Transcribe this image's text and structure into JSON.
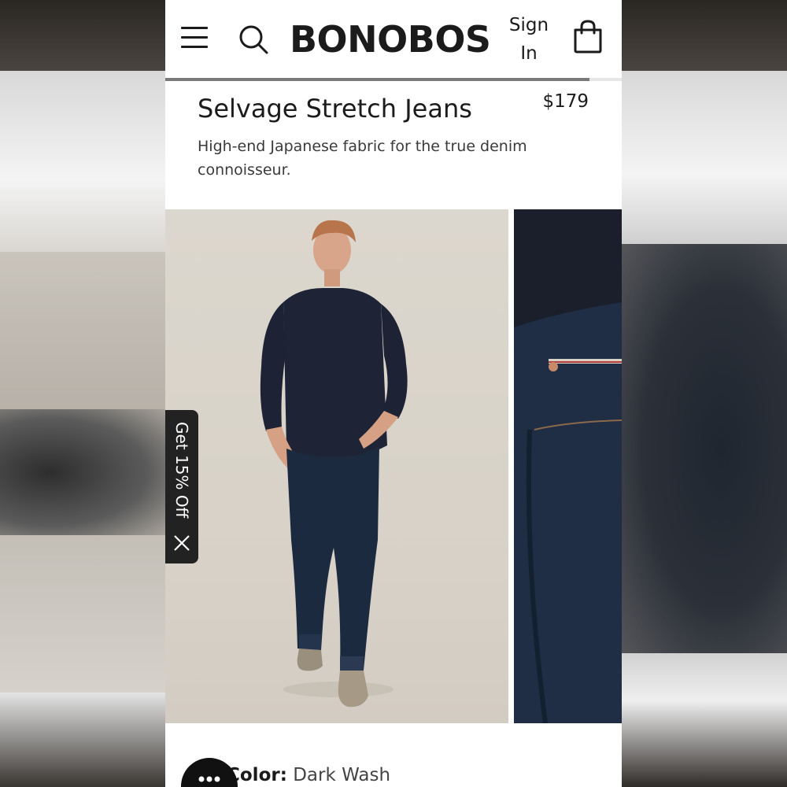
{
  "header": {
    "logo": "BONOBOS",
    "signin_line1": "Sign",
    "signin_line2": "In",
    "menu_icon": "hamburger-menu-icon",
    "search_icon": "search-icon",
    "bag_icon": "shopping-bag-icon"
  },
  "scroll_progress": 0.93,
  "product": {
    "title": "Selvage Stretch Jeans",
    "price": "$179",
    "description": "High-end Japanese fabric for the true denim connoisseur.",
    "color_label": "Color:",
    "color_value": "Dark Wash"
  },
  "promo": {
    "label": "Get 15% Off",
    "close_icon": "close-icon"
  },
  "chat": {
    "icon": "chat-bubble-icon"
  },
  "colors": {
    "text": "#1b1b1b",
    "promo_bg": "#222222",
    "denim": "#1c2a40",
    "shirt": "#1e2436"
  }
}
